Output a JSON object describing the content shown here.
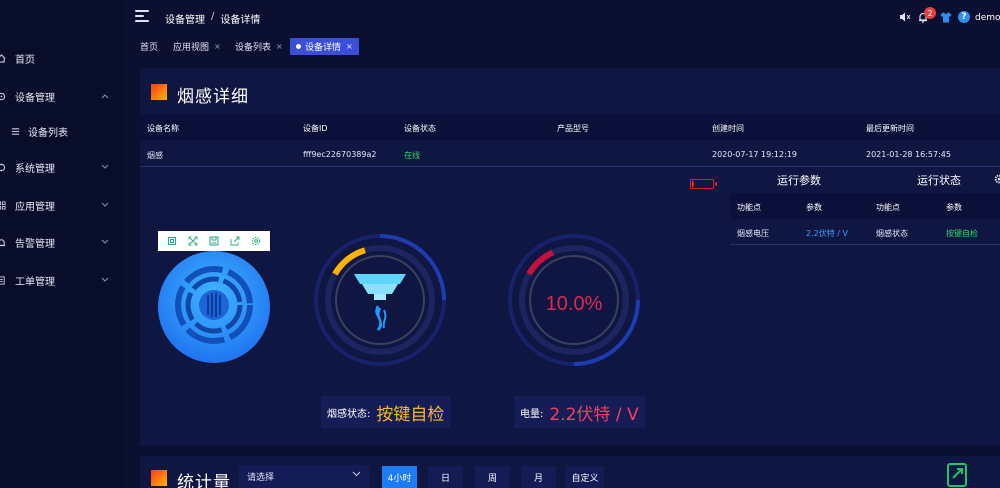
{
  "sidebar": {
    "items": [
      {
        "label": "首页",
        "icon": "home-icon"
      },
      {
        "label": "设备管理",
        "icon": "device-icon",
        "expanded": true
      },
      {
        "label": "设备列表",
        "icon": "list-icon"
      },
      {
        "label": "系统管理",
        "icon": "system-icon"
      },
      {
        "label": "应用管理",
        "icon": "app-icon"
      },
      {
        "label": "告警管理",
        "icon": "alarm-icon"
      },
      {
        "label": "工单管理",
        "icon": "ticket-icon"
      }
    ]
  },
  "header": {
    "breadcrumb": [
      "设备管理",
      "设备详情"
    ],
    "breadcrumb_sep": "/",
    "notification_count": "2",
    "user": "demo"
  },
  "tabs": [
    {
      "label": "首页",
      "closable": false
    },
    {
      "label": "应用视图",
      "closable": true
    },
    {
      "label": "设备列表",
      "closable": true
    },
    {
      "label": "设备详情",
      "closable": true,
      "active": true
    }
  ],
  "tab_close": "×",
  "detail": {
    "title": "烟感详细",
    "columns": [
      "设备名称",
      "设备ID",
      "设备状态",
      "产品型号",
      "创建时间",
      "最后更新时间"
    ],
    "row": {
      "name": "烟感",
      "id": "fff9ec22670389a2",
      "status": "在线",
      "model": "",
      "created": "2020-07-17 19:12:19",
      "updated": "2021-01-28 16:57:45"
    }
  },
  "gauges": {
    "battery_percent_label": "10.0%",
    "battery_percent": 10.0,
    "smoke_level": 0.12
  },
  "readouts": {
    "smoke_status_label": "烟感状态:",
    "smoke_status_value": "按键自检",
    "power_label": "电量:",
    "power_value": "2.2伏特 / V"
  },
  "params": {
    "run_params_title": "运行参数",
    "run_status_title": "运行状态",
    "columns": [
      "功能点",
      "参数",
      "功能点",
      "参数"
    ],
    "row": [
      "烟感电压",
      "2.2伏特 / V",
      "烟感状态",
      "按键自检"
    ]
  },
  "stats": {
    "title": "统计量",
    "select_placeholder": "请选择",
    "periods": [
      "4小时",
      "日",
      "周",
      "月",
      "自定义"
    ],
    "active_period": "4小时"
  },
  "colors": {
    "accent": "#3b4fd6",
    "online": "#2bd96b",
    "param_value": "#34a7ff",
    "status_value": "#2bd96b",
    "readout_status": "#f5b72a",
    "readout_power": "#ff3b5c",
    "gauge_text": "#e0284f"
  }
}
